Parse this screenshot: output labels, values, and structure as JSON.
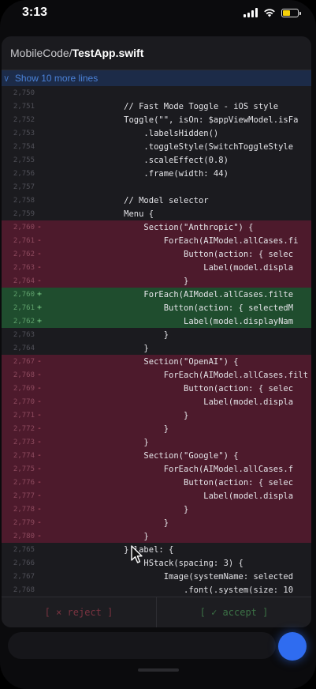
{
  "status": {
    "time": "3:13"
  },
  "header": {
    "path": "MobileCode",
    "separator": "/",
    "filename": "TestApp.swift"
  },
  "expander": {
    "label": "Show 10 more lines"
  },
  "diff_lines": [
    {
      "type": "ctx",
      "num": "2,750",
      "marker": "",
      "text": ""
    },
    {
      "type": "ctx",
      "num": "2,751",
      "marker": "",
      "text": "                // Fast Mode Toggle - iOS style"
    },
    {
      "type": "ctx",
      "num": "2,752",
      "marker": "",
      "text": "                Toggle(\"\", isOn: $appViewModel.isFa"
    },
    {
      "type": "ctx",
      "num": "2,753",
      "marker": "",
      "text": "                    .labelsHidden()"
    },
    {
      "type": "ctx",
      "num": "2,754",
      "marker": "",
      "text": "                    .toggleStyle(SwitchToggleStyle"
    },
    {
      "type": "ctx",
      "num": "2,755",
      "marker": "",
      "text": "                    .scaleEffect(0.8)"
    },
    {
      "type": "ctx",
      "num": "2,756",
      "marker": "",
      "text": "                    .frame(width: 44)"
    },
    {
      "type": "ctx",
      "num": "2,757",
      "marker": "",
      "text": ""
    },
    {
      "type": "ctx",
      "num": "2,758",
      "marker": "",
      "text": "                // Model selector"
    },
    {
      "type": "ctx",
      "num": "2,759",
      "marker": "",
      "text": "                Menu {"
    },
    {
      "type": "del",
      "num": "2,760",
      "marker": "-",
      "text": "                    Section(\"Anthropic\") {"
    },
    {
      "type": "del",
      "num": "2,761",
      "marker": "-",
      "text": "                        ForEach(AIModel.allCases.fi"
    },
    {
      "type": "del",
      "num": "2,762",
      "marker": "-",
      "text": "                            Button(action: { selec"
    },
    {
      "type": "del",
      "num": "2,763",
      "marker": "-",
      "text": "                                Label(model.displa"
    },
    {
      "type": "del",
      "num": "2,764",
      "marker": "-",
      "text": "                            }"
    },
    {
      "type": "add",
      "num": "2,760",
      "marker": "+",
      "text": "                    ForEach(AIModel.allCases.filte"
    },
    {
      "type": "add",
      "num": "2,761",
      "marker": "+",
      "text": "                        Button(action: { selectedM"
    },
    {
      "type": "add",
      "num": "2,762",
      "marker": "+",
      "text": "                            Label(model.displayNam"
    },
    {
      "type": "ctx",
      "num": "2,763",
      "marker": "",
      "text": "                        }"
    },
    {
      "type": "ctx",
      "num": "2,764",
      "marker": "",
      "text": "                    }"
    },
    {
      "type": "del",
      "num": "2,767",
      "marker": "-",
      "text": "                    Section(\"OpenAI\") {"
    },
    {
      "type": "del",
      "num": "2,768",
      "marker": "-",
      "text": "                        ForEach(AIModel.allCases.filt"
    },
    {
      "type": "del",
      "num": "2,769",
      "marker": "-",
      "text": "                            Button(action: { selec"
    },
    {
      "type": "del",
      "num": "2,770",
      "marker": "-",
      "text": "                                Label(model.displa"
    },
    {
      "type": "del",
      "num": "2,771",
      "marker": "-",
      "text": "                            }"
    },
    {
      "type": "del",
      "num": "2,772",
      "marker": "-",
      "text": "                        }"
    },
    {
      "type": "del",
      "num": "2,773",
      "marker": "-",
      "text": "                    }"
    },
    {
      "type": "del",
      "num": "2,774",
      "marker": "-",
      "text": "                    Section(\"Google\") {"
    },
    {
      "type": "del",
      "num": "2,775",
      "marker": "-",
      "text": "                        ForEach(AIModel.allCases.f"
    },
    {
      "type": "del",
      "num": "2,776",
      "marker": "-",
      "text": "                            Button(action: { selec"
    },
    {
      "type": "del",
      "num": "2,777",
      "marker": "-",
      "text": "                                Label(model.displa"
    },
    {
      "type": "del",
      "num": "2,778",
      "marker": "-",
      "text": "                            }"
    },
    {
      "type": "del",
      "num": "2,779",
      "marker": "-",
      "text": "                        }"
    },
    {
      "type": "del",
      "num": "2,780",
      "marker": "-",
      "text": "                    }"
    },
    {
      "type": "ctx",
      "num": "2,765",
      "marker": "",
      "text": "                } label: {"
    },
    {
      "type": "ctx",
      "num": "2,766",
      "marker": "",
      "text": "                    HStack(spacing: 3) {"
    },
    {
      "type": "ctx",
      "num": "2,767",
      "marker": "",
      "text": "                        Image(systemName: selected"
    },
    {
      "type": "ctx",
      "num": "2,768",
      "marker": "",
      "text": "                            .font(.system(size: 10"
    }
  ],
  "actions": {
    "reject_label": "[ × reject ]",
    "accept_label": "[ ✓ accept ]"
  },
  "colors": {
    "deleted_bg": "#4d1a2c",
    "added_bg": "#1f4d2e",
    "accent": "#2f6cf0",
    "expander_text": "#4b82d8",
    "battery": "#f5d10a"
  },
  "icons": [
    "signal-icon",
    "wifi-icon",
    "battery-icon",
    "chevron-icon",
    "cursor-icon"
  ]
}
